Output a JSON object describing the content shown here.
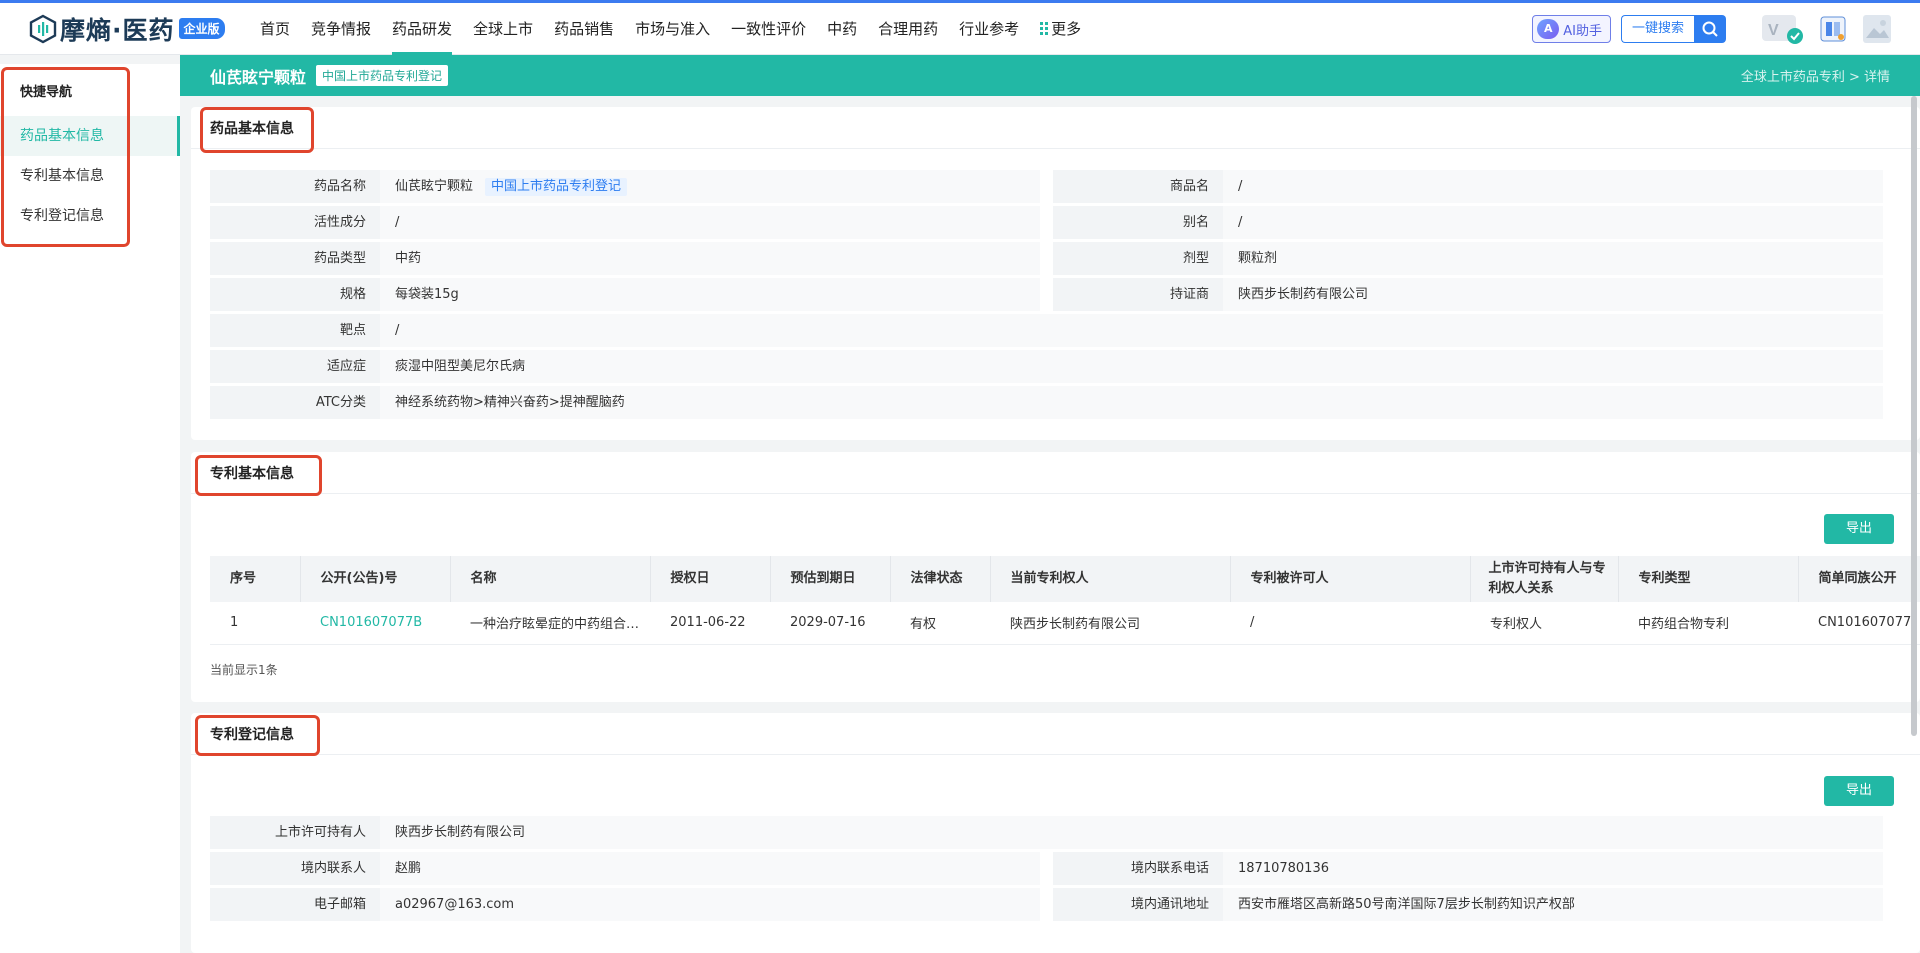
{
  "logo": {
    "text": "摩熵·医药",
    "badge": "企业版",
    "colors": {
      "brand": "#1d3b57",
      "accent": "#22b8a5",
      "blue": "#2d7df0"
    }
  },
  "nav": [
    {
      "label": "首页"
    },
    {
      "label": "竞争情报"
    },
    {
      "label": "药品研发",
      "active": true
    },
    {
      "label": "全球上市"
    },
    {
      "label": "药品销售"
    },
    {
      "label": "市场与准入"
    },
    {
      "label": "一致性评价"
    },
    {
      "label": "中药"
    },
    {
      "label": "合理用药"
    },
    {
      "label": "行业参考"
    },
    {
      "label": "更多"
    }
  ],
  "top_actions": {
    "ai_label": "AI助手",
    "ai_icon": "ai-icon",
    "search_label": "一键搜索",
    "vip_icon": "vip-badge-icon",
    "book_icon": "manual-icon",
    "avatar_icon": "avatar-icon"
  },
  "sidenav": {
    "title": "快捷导航",
    "items": [
      {
        "label": "药品基本信息",
        "active": true
      },
      {
        "label": "专利基本信息"
      },
      {
        "label": "专利登记信息"
      }
    ]
  },
  "header": {
    "title": "仙芪眩宁颗粒",
    "tag": "中国上市药品专利登记",
    "breadcrumb": "全球上市药品专利 > 详情"
  },
  "drug_info": {
    "title": "药品基本信息",
    "fields": {
      "name_k": "药品名称",
      "name_v": "仙芪眩宁颗粒",
      "name_tag": "中国上市药品专利登记",
      "trade_k": "商品名",
      "trade_v": "/",
      "active_k": "活性成分",
      "active_v": "/",
      "alias_k": "别名",
      "alias_v": "/",
      "type_k": "药品类型",
      "type_v": "中药",
      "form_k": "剂型",
      "form_v": "颗粒剂",
      "spec_k": "规格",
      "spec_v": "每袋装15g",
      "holder_k": "持证商",
      "holder_v": "陕西步长制药有限公司",
      "target_k": "靶点",
      "target_v": "/",
      "indication_k": "适应症",
      "indication_v": "痰湿中阻型美尼尔氏病",
      "atc_k": "ATC分类",
      "atc_v": "神经系统药物>精神兴奋药>提神醒脑药"
    }
  },
  "patent_info": {
    "title": "专利基本信息",
    "export_label": "导出",
    "columns": [
      "序号",
      "公开(公告)号",
      "名称",
      "授权日",
      "预估到期日",
      "法律状态",
      "当前专利权人",
      "专利被许可人",
      "上市许可持有人与专利权人关系",
      "专利类型",
      "简单同族公开"
    ],
    "rows": [
      [
        "1",
        "CN101607077B",
        "一种治疗眩晕症的中药组合物…",
        "2011-06-22",
        "2029-07-16",
        "有权",
        "陕西步长制药有限公司",
        "/",
        "专利权人",
        "中药组合物专利",
        "CN101607077"
      ]
    ],
    "count_text": "当前显示1条"
  },
  "registration": {
    "title": "专利登记信息",
    "export_label": "导出",
    "fields": {
      "mah_k": "上市许可持有人",
      "mah_v": "陕西步长制药有限公司",
      "contact_k": "境内联系人",
      "contact_v": "赵鹏",
      "phone_k": "境内联系电话",
      "phone_v": "18710780136",
      "email_k": "电子邮箱",
      "email_v": "a02967@163.com",
      "addr_k": "境内通讯地址",
      "addr_v": "西安市雁塔区高新路50号南洋国际7层步长制药知识产权部"
    }
  }
}
